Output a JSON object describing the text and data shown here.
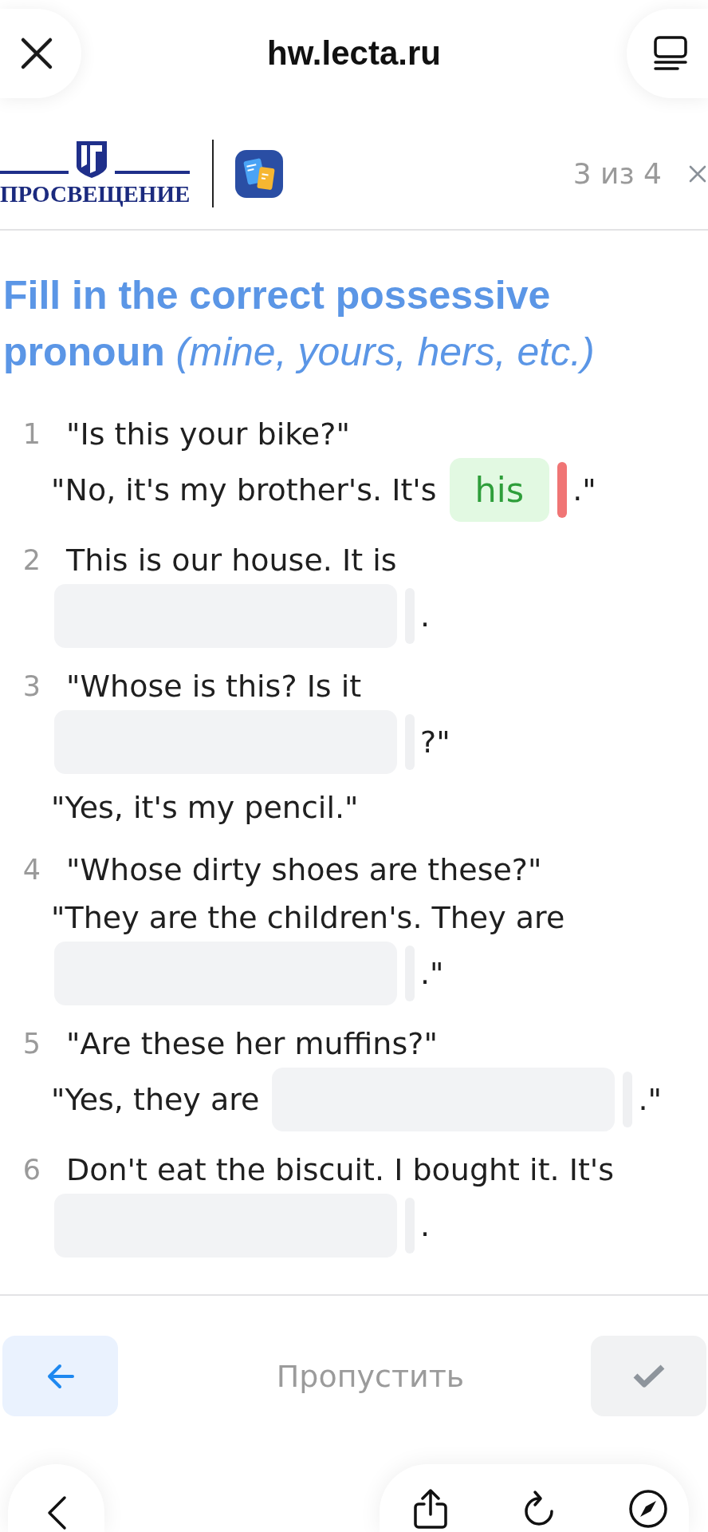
{
  "browser": {
    "url": "hw.lecta.ru"
  },
  "header": {
    "publisher": "ПРОСВЕЩЕНИЕ",
    "progress": "3 из 4"
  },
  "task": {
    "title": "Fill in the correct possessive pronoun *(mine, yours, hers, etc.)*"
  },
  "exercises": [
    {
      "number": "1",
      "lines": [
        [
          {
            "kind": "text",
            "text": "\"Is this your bike?\""
          }
        ],
        [
          {
            "kind": "text",
            "text": "\"No, it's my brother's. It's"
          },
          {
            "kind": "blank",
            "value": "his",
            "correct": true,
            "color": "#f07575"
          },
          {
            "kind": "text",
            "text": ".\""
          }
        ]
      ]
    },
    {
      "number": "2",
      "lines": [
        [
          {
            "kind": "text",
            "text": "This is our house. It is"
          }
        ],
        [
          {
            "kind": "blank",
            "correct": false,
            "color": "#eff0f2"
          },
          {
            "kind": "text",
            "text": "."
          }
        ]
      ]
    },
    {
      "number": "3",
      "lines": [
        [
          {
            "kind": "text",
            "text": "\"Whose is this? Is it"
          }
        ],
        [
          {
            "kind": "blank",
            "correct": false,
            "color": "#eff0f2"
          },
          {
            "kind": "text",
            "text": "?\""
          }
        ],
        [
          {
            "kind": "text",
            "text": "\"Yes, it's my pencil.\""
          }
        ]
      ]
    },
    {
      "number": "4",
      "lines": [
        [
          {
            "kind": "text",
            "text": "\"Whose dirty shoes are these?\""
          }
        ],
        [
          {
            "kind": "text",
            "text": "\"They are the children's. They are"
          }
        ],
        [
          {
            "kind": "blank",
            "correct": false,
            "color": "#eff0f2"
          },
          {
            "kind": "text",
            "text": ".\""
          }
        ]
      ]
    },
    {
      "number": "5",
      "lines": [
        [
          {
            "kind": "text",
            "text": "\"Are these her muffins?\""
          }
        ],
        [
          {
            "kind": "text",
            "text": "\"Yes, they are"
          },
          {
            "kind": "blank",
            "correct": false,
            "color": "#eff0f2"
          },
          {
            "kind": "text",
            "text": ".\""
          }
        ]
      ]
    },
    {
      "number": "6",
      "lines": [
        [
          {
            "kind": "text",
            "text": "Don't eat the biscuit. I bought it. It's"
          }
        ],
        [
          {
            "kind": "blank",
            "correct": false,
            "color": "#eff0f2"
          },
          {
            "kind": "text",
            "text": "."
          }
        ]
      ]
    }
  ],
  "footer": {
    "back_button": {
      "disabled": false
    },
    "skip_label": "Пропустить",
    "check_button": {
      "disabled": true
    }
  }
}
